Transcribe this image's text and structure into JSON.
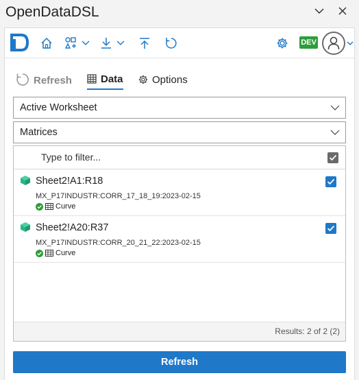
{
  "window": {
    "title": "OpenDataDSL"
  },
  "toolbar": {
    "env_badge": "DEV"
  },
  "tabs": [
    {
      "label": "Refresh"
    },
    {
      "label": "Data"
    },
    {
      "label": "Options"
    }
  ],
  "selects": {
    "source": {
      "value": "Active Worksheet"
    },
    "type": {
      "value": "Matrices"
    }
  },
  "filter": {
    "placeholder": "Type to filter..."
  },
  "items": [
    {
      "name": "Sheet2!A1:R18",
      "id": "MX_P17INDUSTR:CORR_17_18_19:2023-02-15",
      "kind": "Curve",
      "checked": true
    },
    {
      "name": "Sheet2!A20:R37",
      "id": "MX_P17INDUSTR:CORR_20_21_22:2023-02-15",
      "kind": "Curve",
      "checked": true
    }
  ],
  "results": {
    "text": "Results: 2 of 2 (2)"
  },
  "actions": {
    "refresh_label": "Refresh"
  },
  "colors": {
    "accent": "#1f78c8",
    "dev_badge": "#2e9e3a",
    "cube": "#2bb58a",
    "status_ok": "#2e9e3a"
  }
}
